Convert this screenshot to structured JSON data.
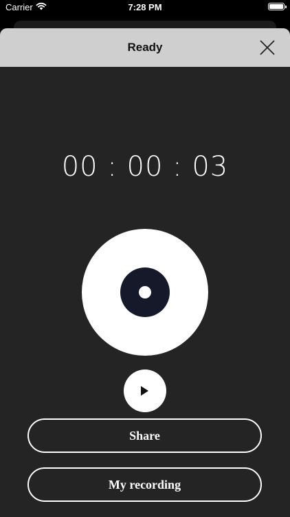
{
  "status_bar": {
    "carrier": "Carrier",
    "time": "7:28 PM",
    "wifi_icon": "wifi-icon",
    "battery_icon": "battery-icon"
  },
  "nav": {
    "title": "Ready",
    "close_icon": "close-icon"
  },
  "timer": {
    "value": "00 : 00 : 03"
  },
  "controls": {
    "record_icon": "record-icon",
    "play_icon": "play-icon"
  },
  "buttons": {
    "share_label": "Share",
    "my_recording_label": "My recording"
  },
  "colors": {
    "sheet_background": "#242424",
    "nav_background": "#cfcfcf",
    "record_center": "#16192a"
  }
}
